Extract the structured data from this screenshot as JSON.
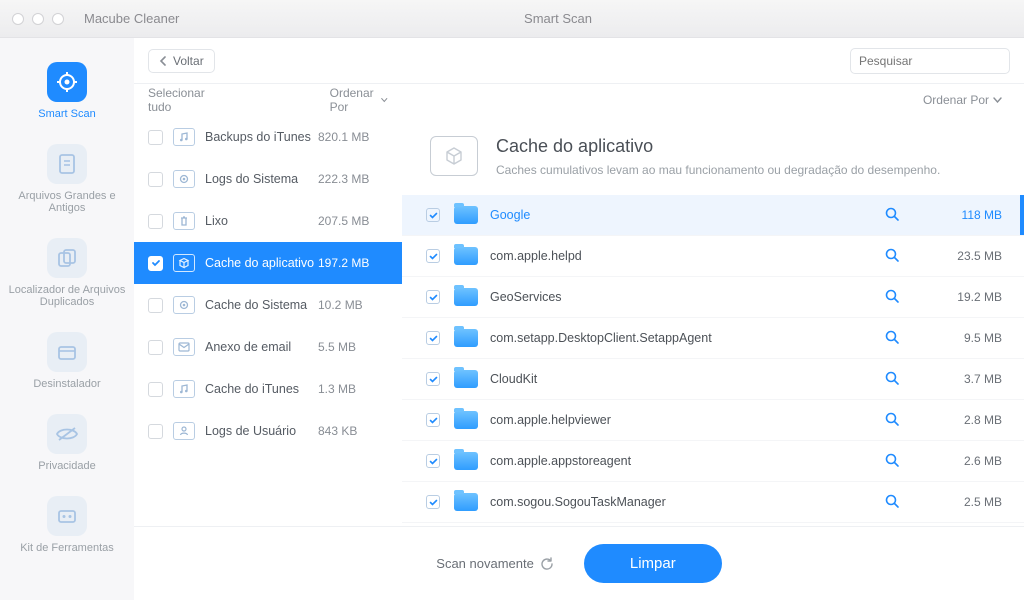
{
  "titlebar": {
    "appName": "Macube Cleaner",
    "pageTitle": "Smart Scan"
  },
  "back": "Voltar",
  "search": {
    "placeholder": "Pesquisar"
  },
  "listHeader": {
    "selectAll": "Selecionar tudo",
    "sortBy": "Ordenar Por"
  },
  "sidebar": [
    {
      "label": "Smart Scan",
      "active": true,
      "icon": "target"
    },
    {
      "label": "Arquivos Grandes e Antigos",
      "icon": "doc"
    },
    {
      "label": "Localizador de Arquivos Duplicados",
      "icon": "dup"
    },
    {
      "label": "Desinstalador",
      "icon": "box"
    },
    {
      "label": "Privacidade",
      "icon": "eye"
    },
    {
      "label": "Kit de Ferramentas",
      "icon": "tool"
    }
  ],
  "categories": [
    {
      "name": "Backups do iTunes",
      "size": "820.1 MB",
      "icon": "music"
    },
    {
      "name": "Logs do Sistema",
      "size": "222.3 MB",
      "icon": "gear"
    },
    {
      "name": "Lixo",
      "size": "207.5 MB",
      "icon": "trash"
    },
    {
      "name": "Cache do aplicativo",
      "size": "197.2 MB",
      "icon": "cube",
      "selected": true
    },
    {
      "name": "Cache do Sistema",
      "size": "10.2 MB",
      "icon": "gear"
    },
    {
      "name": "Anexo de email",
      "size": "5.5 MB",
      "icon": "mail"
    },
    {
      "name": "Cache do iTunes",
      "size": "1.3 MB",
      "icon": "music"
    },
    {
      "name": "Logs de Usuário",
      "size": "843 KB",
      "icon": "user"
    }
  ],
  "detail": {
    "title": "Cache do aplicativo",
    "subtitle": "Caches cumulativos levam ao mau funcionamento ou degradação do desempenho."
  },
  "items": [
    {
      "name": "Google",
      "size": "118 MB",
      "active": true
    },
    {
      "name": "com.apple.helpd",
      "size": "23.5 MB"
    },
    {
      "name": "GeoServices",
      "size": "19.2 MB"
    },
    {
      "name": "com.setapp.DesktopClient.SetappAgent",
      "size": "9.5 MB"
    },
    {
      "name": "CloudKit",
      "size": "3.7 MB"
    },
    {
      "name": "com.apple.helpviewer",
      "size": "2.8 MB"
    },
    {
      "name": "com.apple.appstoreagent",
      "size": "2.6 MB"
    },
    {
      "name": "com.sogou.SogouTaskManager",
      "size": "2.5 MB"
    }
  ],
  "footer": {
    "scanAgain": "Scan novamente",
    "clean": "Limpar"
  }
}
